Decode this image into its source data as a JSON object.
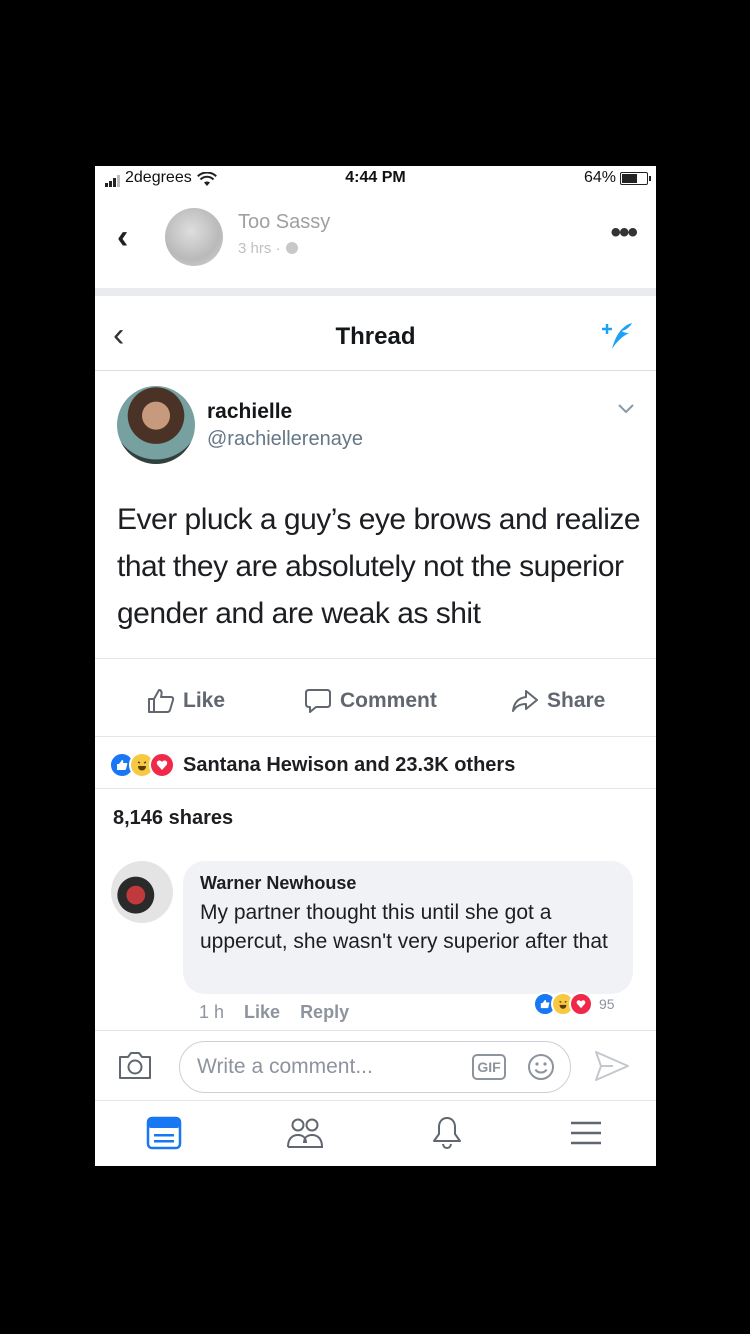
{
  "status_bar": {
    "carrier": "2degrees",
    "time": "4:44 PM",
    "battery": "64%",
    "battery_level": 0.64
  },
  "page_post": {
    "page_name": "Too Sassy",
    "meta": "3 hrs · ",
    "back_icon": "chevron-left-icon",
    "more_icon": "more-dots-icon"
  },
  "thread": {
    "title": "Thread",
    "back_icon": "chevron-left-icon",
    "compose_icon": "compose-tweet-icon"
  },
  "tweet": {
    "name": "rachielle",
    "handle": "@rachiellerenaye",
    "text": "Ever pluck a guy’s eye brows and realize that they are absolutely not the superior gender and are weak as shit"
  },
  "actions": {
    "like": "Like",
    "comment": "Comment",
    "share": "Share"
  },
  "reactions": {
    "summary": "Santana Hewison and 23.3K others",
    "types": [
      "like",
      "haha",
      "love"
    ]
  },
  "shares": "8,146 shares",
  "comment": {
    "author": "Warner Newhouse",
    "text": "My partner thought this until she got a uppercut, she wasn't very superior after that",
    "time": "1 h",
    "like": "Like",
    "reply": "Reply",
    "reaction_count": "95"
  },
  "composer": {
    "placeholder": "Write a comment...",
    "gif": "GIF"
  },
  "tabs": [
    "news-feed-icon",
    "friends-icon",
    "notifications-icon",
    "menu-icon"
  ],
  "colors": {
    "facebook_blue": "#1877f2",
    "haha_yellow": "#f7c942",
    "love_red": "#f0284a"
  }
}
